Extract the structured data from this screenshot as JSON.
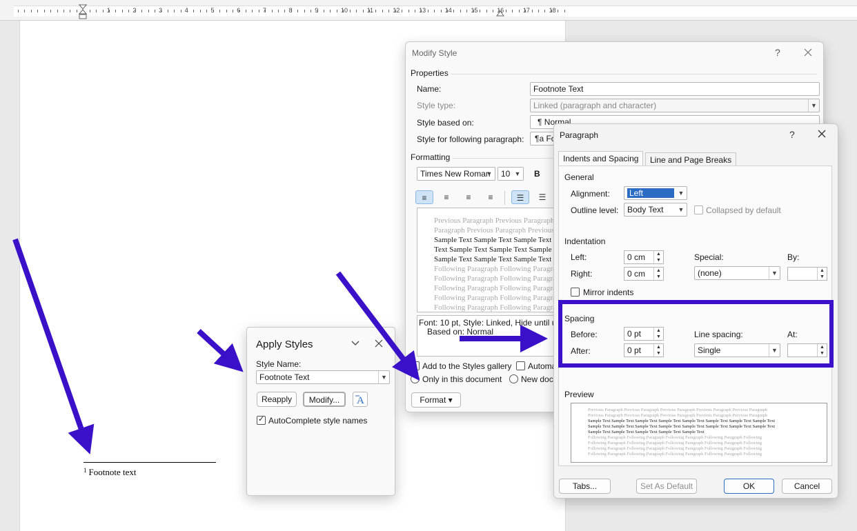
{
  "ruler": {
    "numbers": [
      "1",
      "2",
      "3",
      "4",
      "5",
      "6",
      "7",
      "8",
      "9",
      "10",
      "11",
      "12",
      "13",
      "14",
      "15",
      "16",
      "17",
      "18"
    ]
  },
  "document": {
    "footnote_number": "1",
    "footnote_text": "Footnote text"
  },
  "apply_styles": {
    "title": "Apply Styles",
    "style_name_label": "Style Name:",
    "style_name_value": "Footnote Text",
    "reapply": "Reapply",
    "modify": "Modify...",
    "autocomplete": "AutoComplete style names"
  },
  "modify_style": {
    "title": "Modify Style",
    "help": "?",
    "properties": "Properties",
    "name_label": "Name:",
    "name_value": "Footnote Text",
    "style_type_label": "Style type:",
    "style_type_value": "Linked (paragraph and character)",
    "based_on_label": "Style based on:",
    "based_on_value": "¶  Normal",
    "following_label": "Style for following paragraph:",
    "following_value": "¶a  Fo",
    "formatting": "Formatting",
    "font_value": "Times New Roman",
    "size_value": "10",
    "bold": "B",
    "preview_lines": [
      {
        "text": "Previous Paragraph Previous Paragraph",
        "kind": "gray"
      },
      {
        "text": "Paragraph Previous Paragraph Previous",
        "kind": "gray"
      },
      {
        "text": "Sample Text Sample Text Sample Text",
        "kind": "dark"
      },
      {
        "text": "Text Sample Text Sample Text Sample",
        "kind": "dark"
      },
      {
        "text": "Sample Text Sample Text Sample Text",
        "kind": "dark"
      },
      {
        "text": "Following Paragraph Following Paragraph",
        "kind": "gray"
      },
      {
        "text": "Following Paragraph Following Paragraph",
        "kind": "gray"
      },
      {
        "text": "Following Paragraph Following Paragraph",
        "kind": "gray"
      },
      {
        "text": "Following Paragraph Following Paragraph",
        "kind": "gray"
      },
      {
        "text": "Following Paragraph Following Paragraph",
        "kind": "gray"
      }
    ],
    "description_line1": "Font: 10 pt, Style: Linked, Hide until us",
    "description_line2": "Based on: Normal",
    "add_to_gallery": "Add to the Styles gallery",
    "auto_update": "Automa",
    "only_this_doc": "Only in this document",
    "new_docs": "New docu",
    "format_button": "Format ▾"
  },
  "paragraph": {
    "title": "Paragraph",
    "help": "?",
    "tab_indents": "Indents and Spacing",
    "tab_breaks": "Line and Page Breaks",
    "general": "General",
    "alignment_label": "Alignment:",
    "alignment_value": "Left",
    "outline_label": "Outline level:",
    "outline_value": "Body Text",
    "collapsed": "Collapsed by default",
    "indentation": "Indentation",
    "left_label": "Left:",
    "left_value": "0 cm",
    "right_label": "Right:",
    "right_value": "0 cm",
    "special_label": "Special:",
    "special_value": "(none)",
    "by_label": "By:",
    "mirror": "Mirror indents",
    "spacing": "Spacing",
    "before_label": "Before:",
    "before_value": "0 pt",
    "after_label": "After:",
    "after_value": "0 pt",
    "line_spacing_label": "Line spacing:",
    "line_spacing_value": "Single",
    "at_label": "At:",
    "preview": "Preview",
    "preview_lines": [
      {
        "text": "Previous Paragraph Previous Paragraph Previous Paragraph Previous Paragraph Previous Paragraph",
        "kind": "gray"
      },
      {
        "text": "Previous Paragraph Previous Paragraph Previous Paragraph Previous Paragraph Previous Paragraph",
        "kind": "gray"
      },
      {
        "text": "Sample Text Sample Text Sample Text Sample Text Sample Text Sample Text Sample Text Sample Text",
        "kind": "dark"
      },
      {
        "text": "Sample Text Sample Text Sample Text Sample Text Sample Text Sample Text Sample Text Sample Text",
        "kind": "dark"
      },
      {
        "text": "Sample Text Sample Text Sample Text Sample Text Sample Text",
        "kind": "dark"
      },
      {
        "text": "Following Paragraph Following Paragraph Following Paragraph Following Paragraph Following",
        "kind": "gray"
      },
      {
        "text": "Following Paragraph Following Paragraph Following Paragraph Following Paragraph Following",
        "kind": "gray"
      },
      {
        "text": "Following Paragraph Following Paragraph Following Paragraph Following Paragraph Following",
        "kind": "gray"
      },
      {
        "text": "Following Paragraph Following Paragraph Following Paragraph Following Paragraph Following",
        "kind": "gray"
      }
    ],
    "tabs_button": "Tabs...",
    "set_default": "Set As Default",
    "ok": "OK",
    "cancel": "Cancel"
  },
  "colors": {
    "annotation": "#3a10c8",
    "accent": "#2b6cc4"
  }
}
